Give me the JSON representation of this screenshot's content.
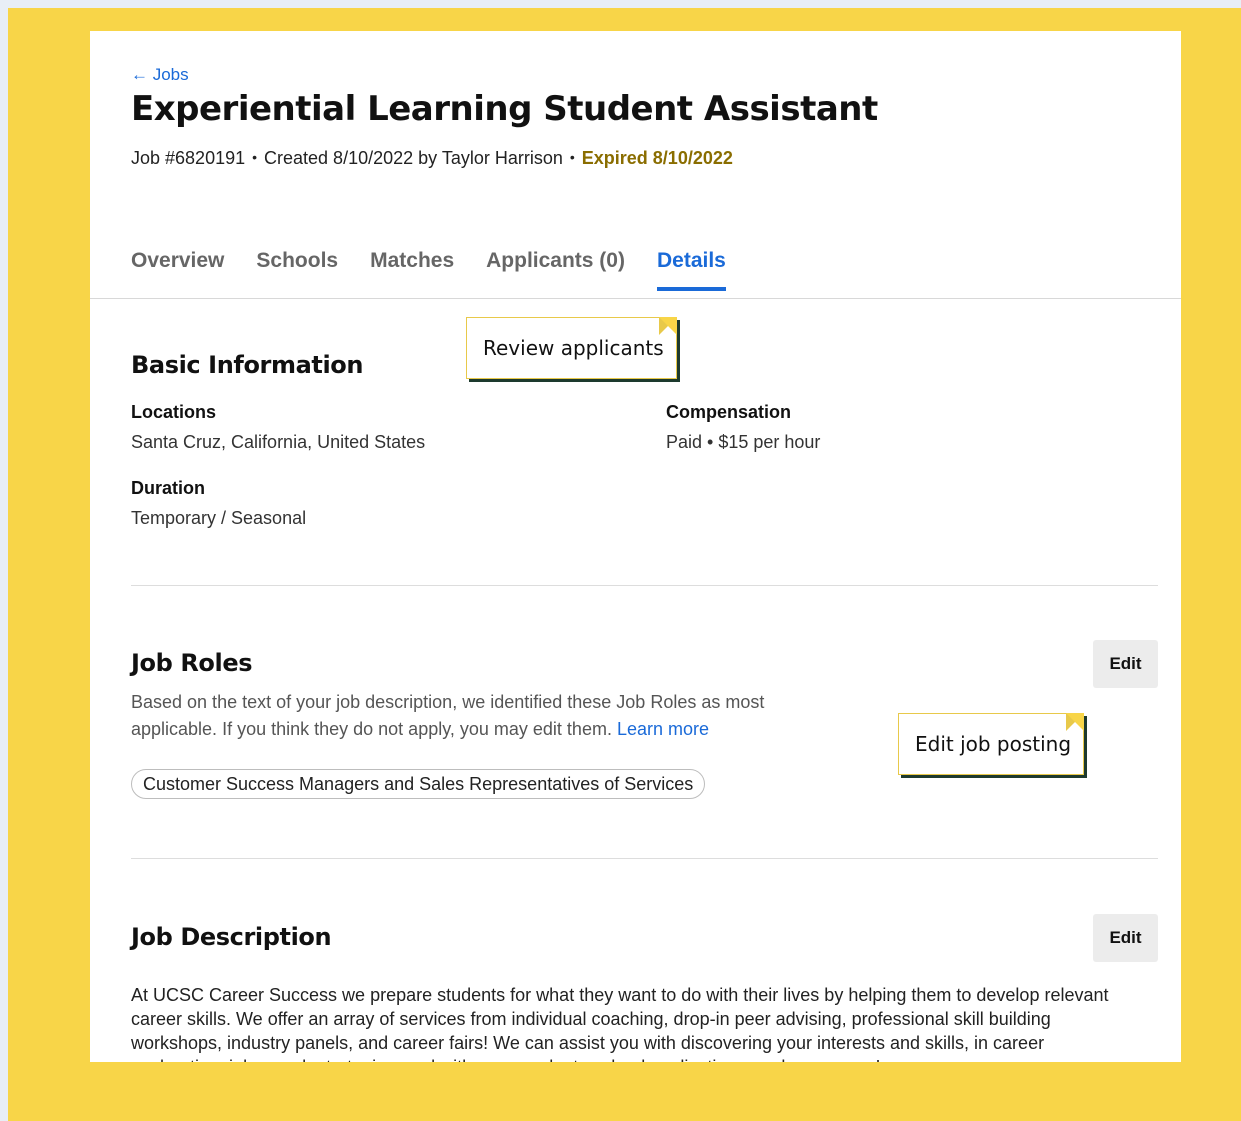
{
  "header": {
    "back_link": "← Jobs",
    "title": "Experiential Learning Student Assistant",
    "job_number": "Job #6820191",
    "created": "Created 8/10/2022 by Taylor Harrison",
    "expired": "Expired 8/10/2022",
    "separator": "•"
  },
  "tabs": [
    {
      "label": "Overview"
    },
    {
      "label": "Schools"
    },
    {
      "label": "Matches"
    },
    {
      "label": "Applicants (0)"
    },
    {
      "label": "Details",
      "active": true
    }
  ],
  "basic_info": {
    "heading": "Basic Information",
    "locations_label": "Locations",
    "locations_value": "Santa Cruz, California, United States",
    "compensation_label": "Compensation",
    "compensation_value": "Paid • $15 per hour",
    "duration_label": "Duration",
    "duration_value": "Temporary / Seasonal"
  },
  "job_roles": {
    "heading": "Job Roles",
    "edit_label": "Edit",
    "helper_text": "Based on the text of your job description, we identified these Job Roles as most applicable. If you think they do not apply, you may edit them.",
    "learn_more": "Learn more",
    "role_chip": "Customer Success Managers and Sales Representatives of Services"
  },
  "job_description": {
    "heading": "Job Description",
    "edit_label": "Edit",
    "body": "At UCSC Career Success we prepare students for what they want to do with their lives by helping them to develop relevant career skills. We offer an array of services from individual coaching, drop-in peer advising, professional skill building workshops, industry panels, and career fairs! We can assist you with discovering your interests and skills, in career exploration, job search strategies, and with your graduate school applications, and even more!"
  },
  "callouts": {
    "review": "Review applicants",
    "edit_posting": "Edit job posting"
  },
  "colors": {
    "background_frame": "#f8d548",
    "accent_blue": "#1a6ad8",
    "expired_gold": "#8a6d00"
  }
}
